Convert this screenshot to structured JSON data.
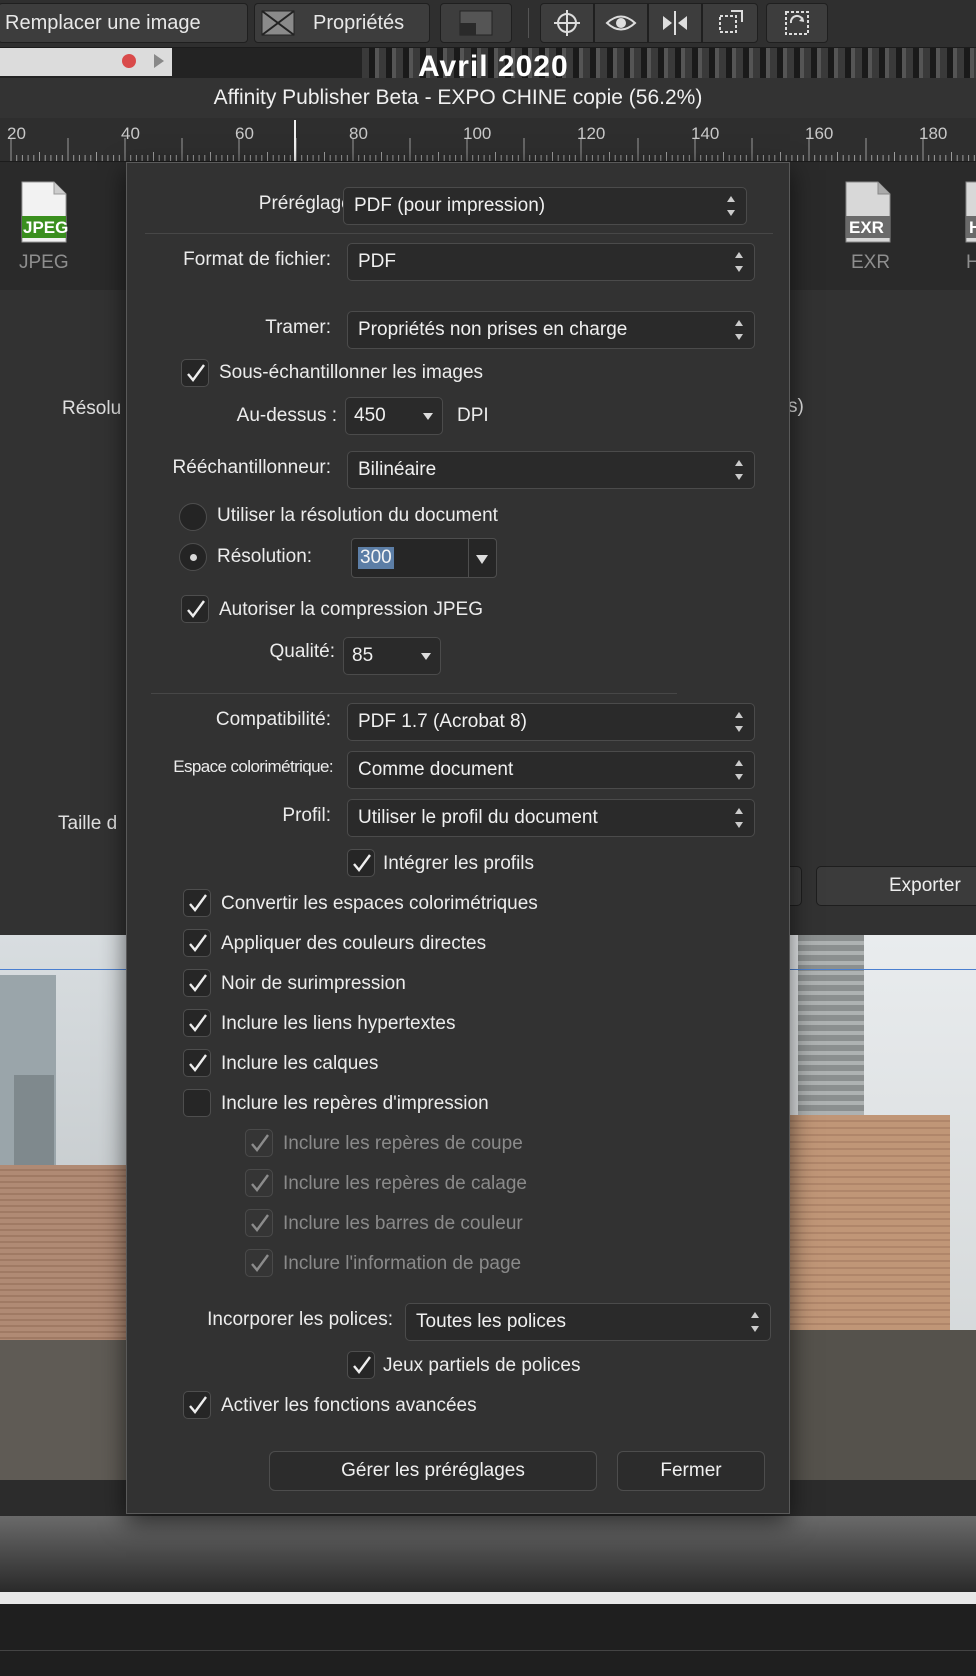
{
  "toolbar": {
    "replace_image": "Remplacer une image",
    "properties": "Propriétés"
  },
  "strip": {
    "photo_text": "Avril 2020"
  },
  "window": {
    "title": "Affinity Publisher Beta - EXPO CHINE copie (56.2%)"
  },
  "ruler": {
    "ticks": [
      "20",
      "40",
      "60",
      "80",
      "100",
      "120",
      "140",
      "160",
      "180"
    ]
  },
  "export_window": {
    "formats": [
      {
        "label": "JPEG",
        "icon_text": "JPEG",
        "icon_color": "#3a8f1e"
      },
      {
        "label": "EXR",
        "icon_text": "EXR",
        "icon_color": "#6a6a6a"
      },
      {
        "label": "H",
        "icon_text": "H",
        "icon_color": "#6a6a6a"
      }
    ],
    "side_left_1": "Résolu",
    "side_right_1": "s)",
    "side_left_2": "Taille d",
    "export_button": "Exporter"
  },
  "dialog": {
    "preset_label": "Préréglage:",
    "preset_value": "PDF (pour impression)",
    "format_label": "Format de fichier:",
    "format_value": "PDF",
    "raster_label": "Tramer:",
    "raster_value": "Propriétés non prises en charge",
    "downsample_label": "Sous-échantillonner les images",
    "downsample_checked": true,
    "above_label": "Au-dessus :",
    "above_value": "450",
    "dpi_label": "DPI",
    "resampler_label": "Rééchantillonneur:",
    "resampler_value": "Bilinéaire",
    "use_doc_res_label": "Utiliser la résolution du document",
    "resolution_label": "Résolution:",
    "resolution_value": "300",
    "jpeg_label": "Autoriser la compression JPEG",
    "jpeg_checked": true,
    "quality_label": "Qualité:",
    "quality_value": "85",
    "compat_label": "Compatibilité:",
    "compat_value": "PDF 1.7 (Acrobat 8)",
    "colorspace_label": "Espace colorimétrique:",
    "colorspace_value": "Comme document",
    "profile_label": "Profil:",
    "profile_value": "Utiliser le profil du document",
    "embed_profiles_label": "Intégrer les profils",
    "checkboxes": [
      {
        "label": "Convertir les espaces colorimétriques",
        "checked": true
      },
      {
        "label": "Appliquer des couleurs directes",
        "checked": true
      },
      {
        "label": "Noir de surimpression",
        "checked": true
      },
      {
        "label": "Inclure les liens hypertextes",
        "checked": true
      },
      {
        "label": "Inclure les calques",
        "checked": true
      },
      {
        "label": "Inclure les repères d'impression",
        "checked": false
      }
    ],
    "print_marks": [
      {
        "label": "Inclure les repères de coupe",
        "checked": true,
        "disabled": true
      },
      {
        "label": "Inclure les repères de calage",
        "checked": true,
        "disabled": true
      },
      {
        "label": "Inclure les barres de couleur",
        "checked": true,
        "disabled": true
      },
      {
        "label": "Inclure l'information de page",
        "checked": true,
        "disabled": true
      }
    ],
    "embed_fonts_label": "Incorporer les polices:",
    "embed_fonts_value": "Toutes les polices",
    "subset_fonts_label": "Jeux partiels de polices",
    "advanced_label": "Activer les fonctions avancées",
    "manage_presets_button": "Gérer les préréglages",
    "close_button": "Fermer"
  },
  "colors": {
    "accent_selection": "#5c7ea6",
    "guide_blue": "#4a7fd0",
    "dialog_bg": "#323232"
  }
}
